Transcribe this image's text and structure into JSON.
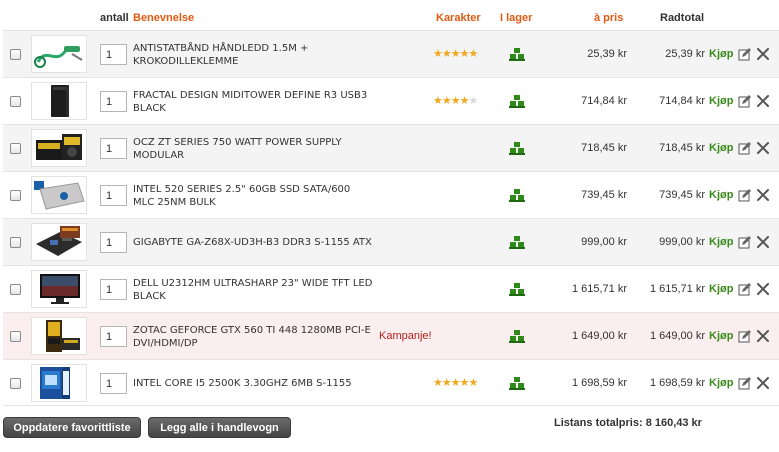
{
  "headers": {
    "quantity": "antall",
    "description": "Benevnelse",
    "rating": "Karakter",
    "stock": "I lager",
    "unit_price": "à pris",
    "row_total": "Radtotal"
  },
  "colors": {
    "accent_orange": "#e05a14",
    "buy_green": "#3a8a1c",
    "campaign_red": "#b22222",
    "star_gold": "#f0a81c"
  },
  "rows": [
    {
      "qty": "1",
      "name": "ANTISTATBÅND HÅNDLEDD 1.5M + KROKODILLEKLEMME",
      "rating": 5,
      "campaign": "",
      "in_stock": true,
      "unit_price": "25,39 kr",
      "row_total": "25,39 kr",
      "buy": "Kjøp",
      "thumb": "antistatic-strap"
    },
    {
      "qty": "1",
      "name": "FRACTAL DESIGN MIDITOWER DEFINE R3 USB3 BLACK",
      "rating": 4,
      "campaign": "",
      "in_stock": true,
      "unit_price": "714,84 kr",
      "row_total": "714,84 kr",
      "buy": "Kjøp",
      "thumb": "pc-case"
    },
    {
      "qty": "1",
      "name": "OCZ ZT SERIES 750 WATT POWER SUPPLY MODULAR",
      "rating": 0,
      "campaign": "",
      "in_stock": true,
      "unit_price": "718,45 kr",
      "row_total": "718,45 kr",
      "buy": "Kjøp",
      "thumb": "power-supply"
    },
    {
      "qty": "1",
      "name": "INTEL 520 SERIES 2.5\" 60GB SSD SATA/600 MLC 25NM BULK",
      "rating": 0,
      "campaign": "",
      "in_stock": true,
      "unit_price": "739,45 kr",
      "row_total": "739,45 kr",
      "buy": "Kjøp",
      "thumb": "ssd"
    },
    {
      "qty": "1",
      "name": "GIGABYTE GA-Z68X-UD3H-B3 DDR3 S-1155 ATX",
      "rating": 0,
      "campaign": "",
      "in_stock": true,
      "unit_price": "999,00 kr",
      "row_total": "999,00 kr",
      "buy": "Kjøp",
      "thumb": "motherboard"
    },
    {
      "qty": "1",
      "name": "DELL U2312HM ULTRASHARP 23\" WIDE TFT LED BLACK",
      "rating": 0,
      "campaign": "",
      "in_stock": true,
      "unit_price": "1 615,71 kr",
      "row_total": "1 615,71 kr",
      "buy": "Kjøp",
      "thumb": "monitor"
    },
    {
      "qty": "1",
      "name": "ZOTAC GEFORCE GTX 560 TI 448 1280MB PCI-E DVI/HDMI/DP",
      "rating": 0,
      "campaign": "Kampanje!",
      "in_stock": true,
      "unit_price": "1 649,00 kr",
      "row_total": "1 649,00 kr",
      "buy": "Kjøp",
      "thumb": "graphics-card"
    },
    {
      "qty": "1",
      "name": "INTEL CORE I5 2500K 3.30GHZ 6MB S-1155",
      "rating": 5,
      "campaign": "",
      "in_stock": true,
      "unit_price": "1 698,59 kr",
      "row_total": "1 698,59 kr",
      "buy": "Kjøp",
      "thumb": "cpu-box"
    }
  ],
  "footer": {
    "update_button": "Oppdatere favorittliste",
    "add_all_button": "Legg alle i handlevogn",
    "total_label": "Listans totalpris:",
    "total_value": "8 160,43 kr"
  }
}
